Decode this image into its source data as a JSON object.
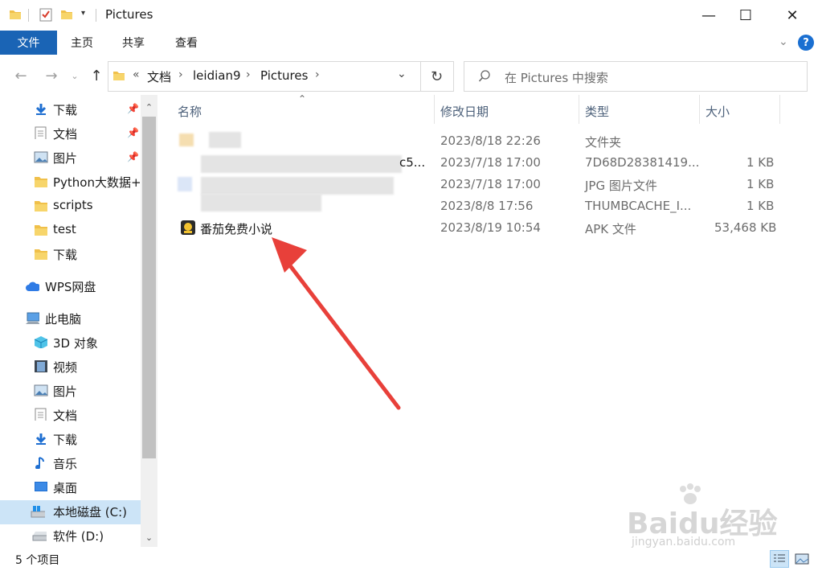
{
  "window": {
    "title": "Pictures",
    "minimize": "—",
    "maximize": "☐",
    "close": "✕"
  },
  "ribbon": {
    "tabs": [
      "文件",
      "主页",
      "共享",
      "查看"
    ],
    "help": "?"
  },
  "address": {
    "overflow": "«",
    "crumbs": [
      "文档",
      "leidian9",
      "Pictures"
    ],
    "search_placeholder": "在 Pictures 中搜索"
  },
  "sidebar": {
    "quick": [
      {
        "label": "下载",
        "icon": "download-arrow-icon",
        "pinned": true
      },
      {
        "label": "文档",
        "icon": "document-icon",
        "pinned": true
      },
      {
        "label": "图片",
        "icon": "picture-icon",
        "pinned": true
      },
      {
        "label": "Python大数据+人",
        "icon": "folder-icon",
        "pinned": false
      },
      {
        "label": "scripts",
        "icon": "folder-icon",
        "pinned": false
      },
      {
        "label": "test",
        "icon": "folder-icon",
        "pinned": false
      },
      {
        "label": "下载",
        "icon": "folder-icon",
        "pinned": false
      }
    ],
    "cloud": {
      "label": "WPS网盘",
      "icon": "cloud-icon"
    },
    "pc": {
      "label": "此电脑",
      "icon": "computer-icon"
    },
    "pc_items": [
      {
        "label": "3D 对象",
        "icon": "cube-3d-icon"
      },
      {
        "label": "视频",
        "icon": "video-film-icon"
      },
      {
        "label": "图片",
        "icon": "picture-icon"
      },
      {
        "label": "文档",
        "icon": "document-icon"
      },
      {
        "label": "下载",
        "icon": "download-arrow-icon"
      },
      {
        "label": "音乐",
        "icon": "music-note-icon"
      },
      {
        "label": "桌面",
        "icon": "desktop-icon"
      },
      {
        "label": "本地磁盘 (C:)",
        "icon": "windows-drive-icon",
        "selected": true
      },
      {
        "label": "软件 (D:)",
        "icon": "drive-icon"
      }
    ]
  },
  "columns": [
    "名称",
    "修改日期",
    "类型",
    "大小"
  ],
  "files": [
    {
      "name": "",
      "date": "2023/8/18 22:26",
      "type": "文件夹",
      "size": ""
    },
    {
      "name": "c5...",
      "date": "2023/7/18 17:00",
      "type": "7D68D28381419...",
      "size": "1 KB"
    },
    {
      "name": "",
      "date": "2023/7/18 17:00",
      "type": "JPG 图片文件",
      "size": "1 KB"
    },
    {
      "name": "",
      "date": "2023/8/8 17:56",
      "type": "THUMBCACHE_I...",
      "size": "1 KB"
    },
    {
      "name": "番茄免费小说",
      "date": "2023/8/19 10:54",
      "type": "APK 文件",
      "size": "53,468 KB"
    }
  ],
  "status": {
    "count": "5 个项目"
  },
  "watermark": {
    "brand": "Baidu经验",
    "url": "jingyan.baidu.com"
  },
  "colors": {
    "accent": "#1a64b5",
    "selection": "#cce4f7",
    "arrow": "#e8403a"
  }
}
